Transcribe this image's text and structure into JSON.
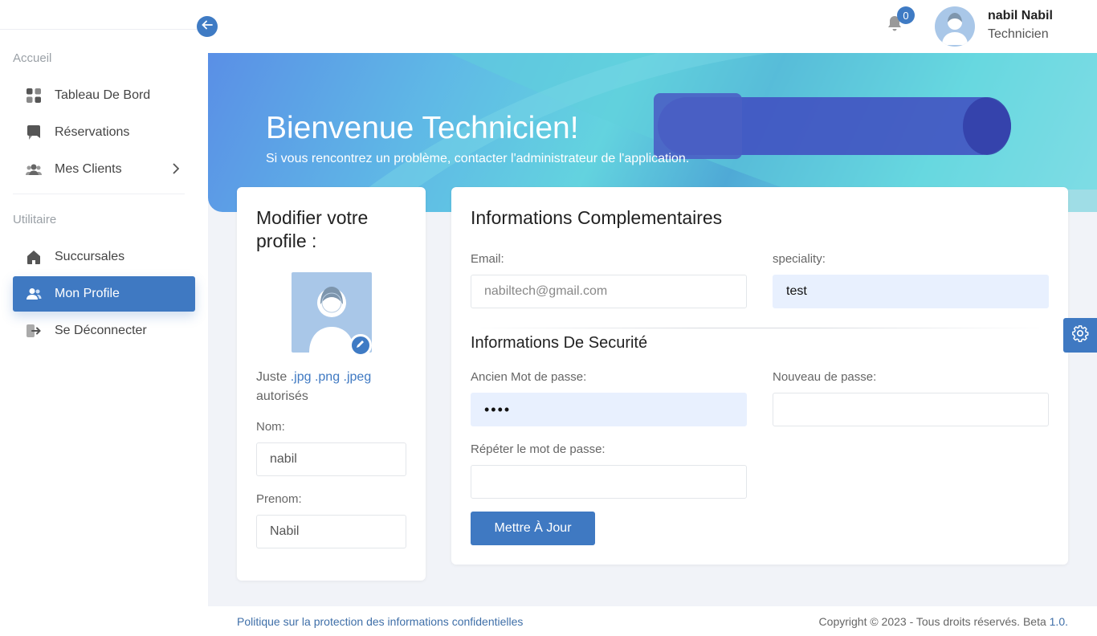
{
  "sidebar": {
    "sections": [
      "Accueil",
      "Utilitaire"
    ],
    "items": [
      {
        "label": "Tableau De Bord",
        "icon": "dashboard-icon"
      },
      {
        "label": "Réservations",
        "icon": "bookmark-icon"
      },
      {
        "label": "Mes Clients",
        "icon": "users-icon"
      },
      {
        "label": "Succursales",
        "icon": "home-icon"
      },
      {
        "label": "Mon Profile",
        "icon": "user-icon",
        "active": true
      },
      {
        "label": "Se Déconnecter",
        "icon": "logout-icon"
      }
    ]
  },
  "header": {
    "notifications_count": "0",
    "user_name": "nabil Nabil",
    "user_role": "Technicien"
  },
  "banner": {
    "title": "Bienvenue Technicien!",
    "subtitle": "Si vous rencontrez un problème, contacter l'administrateur de l'application."
  },
  "profile_card": {
    "title": "Modifier votre profile :",
    "hint_prefix": "Juste",
    "hint_ext": ".jpg .png .jpeg",
    "hint_suffix": "autorisés",
    "nom_label": "Nom:",
    "nom_value": "nabil",
    "prenom_label": "Prenom:",
    "prenom_value": "Nabil"
  },
  "info_card": {
    "title": "Informations Complementaires",
    "email_label": "Email:",
    "email_placeholder": "nabiltech@gmail.com",
    "speciality_label": "speciality:",
    "speciality_value": "test",
    "security_title": "Informations De Securité",
    "old_password_label": "Ancien Mot de passe:",
    "old_password_value": "••••",
    "new_password_label": "Nouveau de passe:",
    "repeat_password_label": "Répéter le mot de passe:",
    "submit_label": "Mettre À Jour"
  },
  "footer": {
    "privacy_link": "Politique sur la protection des informations confidentielles",
    "copyright": "Copyright © 2023 - Tous droits réservés. Beta ",
    "version": "1.0."
  },
  "colors": {
    "accent": "#3f79c2",
    "input_filled": "#e8f0fe"
  }
}
